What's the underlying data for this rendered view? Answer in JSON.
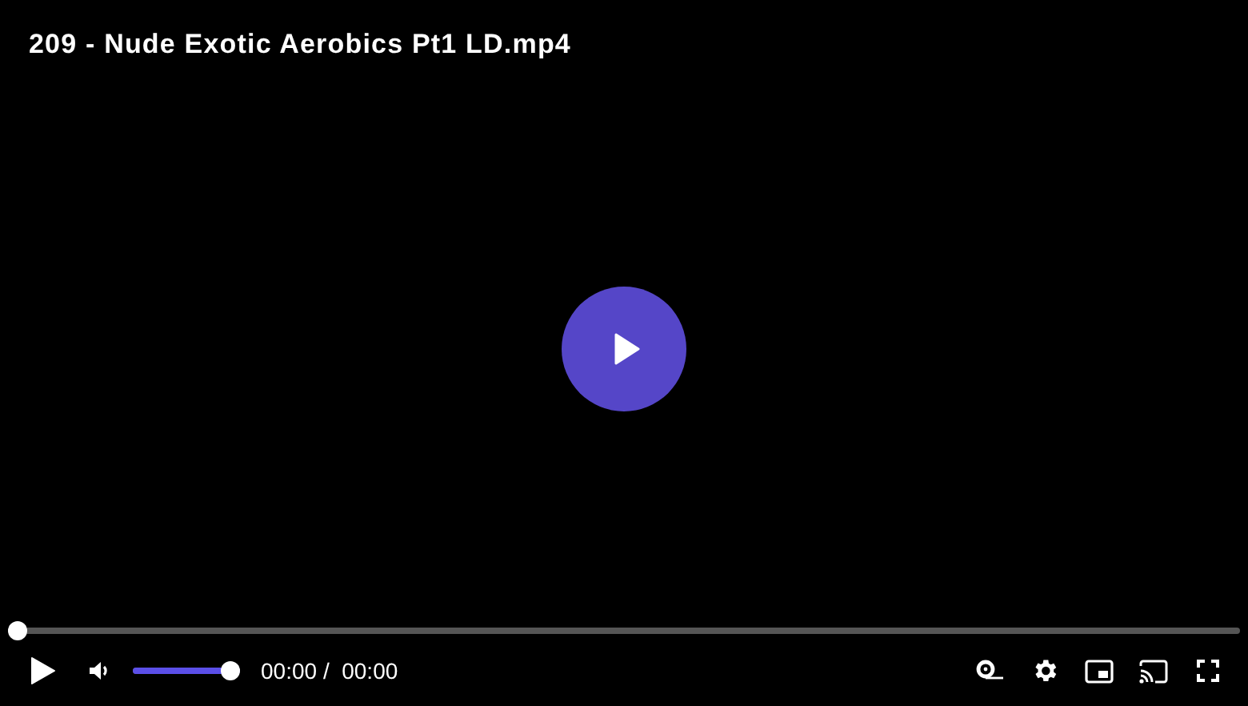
{
  "title": "209 - Nude Exotic Aerobics Pt1 LD.mp4",
  "progress": {
    "level": 0
  },
  "volume": {
    "muted": false,
    "level": 1
  },
  "time": {
    "current": "00:00",
    "separator": "/",
    "duration": "00:00"
  }
}
